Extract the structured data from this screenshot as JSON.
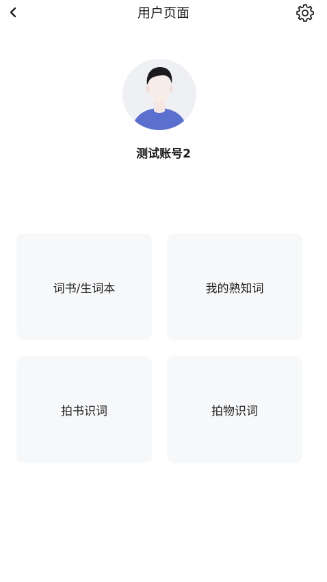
{
  "header": {
    "title": "用户页面",
    "back_icon": "chevron-left-icon",
    "settings_icon": "gear-icon"
  },
  "profile": {
    "avatar_icon": "default-user-avatar",
    "username": "测试账号2"
  },
  "menu": {
    "items": [
      {
        "label": "词书/生词本"
      },
      {
        "label": "我的熟知词"
      },
      {
        "label": "拍书识词"
      },
      {
        "label": "拍物识词"
      }
    ]
  },
  "colors": {
    "card_background": "#f7f8fa",
    "avatar_background": "#eef0f3",
    "avatar_shirt": "#5b6fcf",
    "text_primary": "#1a1a1a"
  }
}
